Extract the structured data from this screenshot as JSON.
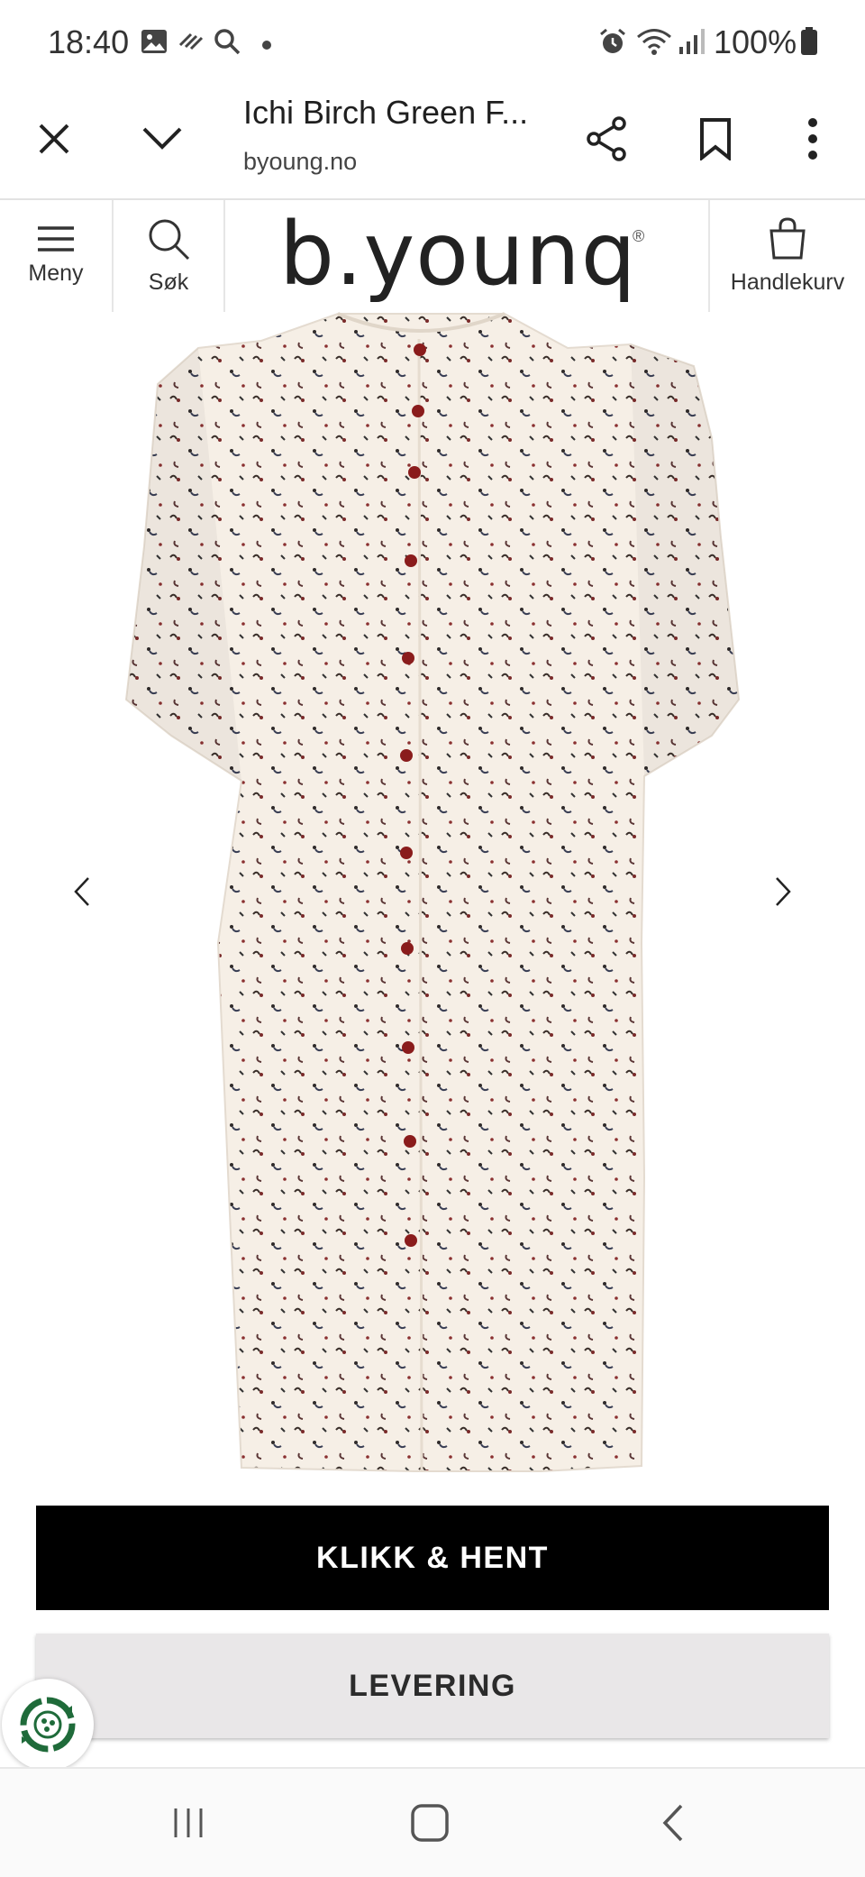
{
  "status_bar": {
    "time": "18:40",
    "battery": "100%",
    "icons": [
      "gallery-icon",
      "missed-call-icon",
      "search-icon",
      "dot-icon",
      "alarm-icon",
      "wifi-icon",
      "signal-icon",
      "battery-icon"
    ]
  },
  "toolbar": {
    "title": "Ichi Birch Green F...",
    "url": "byoung.no",
    "icons": [
      "close-icon",
      "chevron-down-icon",
      "share-icon",
      "bookmark-icon",
      "more-vert-icon"
    ]
  },
  "site_header": {
    "menu_label": "Meny",
    "search_label": "Søk",
    "logo_text": "b.younq",
    "logo_mark": "®",
    "cart_label": "Handlekurv"
  },
  "product": {
    "image": "product-photo",
    "prev_icon": "chevron-left-icon",
    "next_icon": "chevron-right-icon",
    "fabric_color": "#f6efe6",
    "button_color": "#8a1c1c"
  },
  "actions": {
    "click_collect": "KLIKK & HENT",
    "delivery": "LEVERING"
  },
  "badge": {
    "icon": "recycle-badge-icon",
    "color": "#1f6b3a"
  },
  "nav_bar": {
    "icons": [
      "recents-icon",
      "home-icon",
      "back-icon"
    ]
  }
}
